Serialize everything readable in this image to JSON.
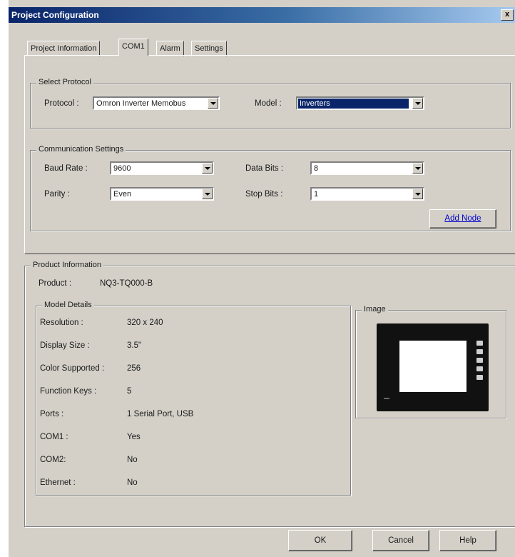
{
  "window": {
    "title": "Project Configuration",
    "close_glyph": "x"
  },
  "tabs": [
    {
      "label": "Project Information",
      "active": false
    },
    {
      "label": "COM1",
      "active": true
    },
    {
      "label": "Alarm",
      "active": false
    },
    {
      "label": "Settings",
      "active": false
    }
  ],
  "select_protocol": {
    "group_label": "Select Protocol",
    "protocol_label": "Protocol :",
    "protocol_value": "Omron Inverter Memobus",
    "model_label": "Model :",
    "model_value": "Inverters"
  },
  "comm_settings": {
    "group_label": "Communication Settings",
    "baud_rate_label": "Baud Rate :",
    "baud_rate_value": "9600",
    "data_bits_label": "Data Bits :",
    "data_bits_value": "8",
    "parity_label": "Parity :",
    "parity_value": "Even",
    "stop_bits_label": "Stop Bits :",
    "stop_bits_value": "1",
    "add_node_label": "Add Node"
  },
  "product_info": {
    "group_label": "Product Information",
    "product_label": "Product :",
    "product_value": "NQ3-TQ000-B",
    "model_details_label": "Model Details",
    "details": [
      {
        "label": "Resolution :",
        "value": "320 x 240"
      },
      {
        "label": "Display Size :",
        "value": "3.5\""
      },
      {
        "label": "Color Supported :",
        "value": "256"
      },
      {
        "label": "Function Keys :",
        "value": "5"
      },
      {
        "label": "Ports :",
        "value": "1 Serial Port, USB"
      },
      {
        "label": "COM1 :",
        "value": "Yes"
      },
      {
        "label": "COM2:",
        "value": "No"
      },
      {
        "label": "Ethernet :",
        "value": "No"
      }
    ],
    "image_label": "Image"
  },
  "buttons": {
    "ok": "OK",
    "cancel": "Cancel",
    "help": "Help"
  },
  "colors": {
    "title_bar": "#0a246a",
    "selection": "#0a246a",
    "dialog_face": "#d4d0c8"
  }
}
